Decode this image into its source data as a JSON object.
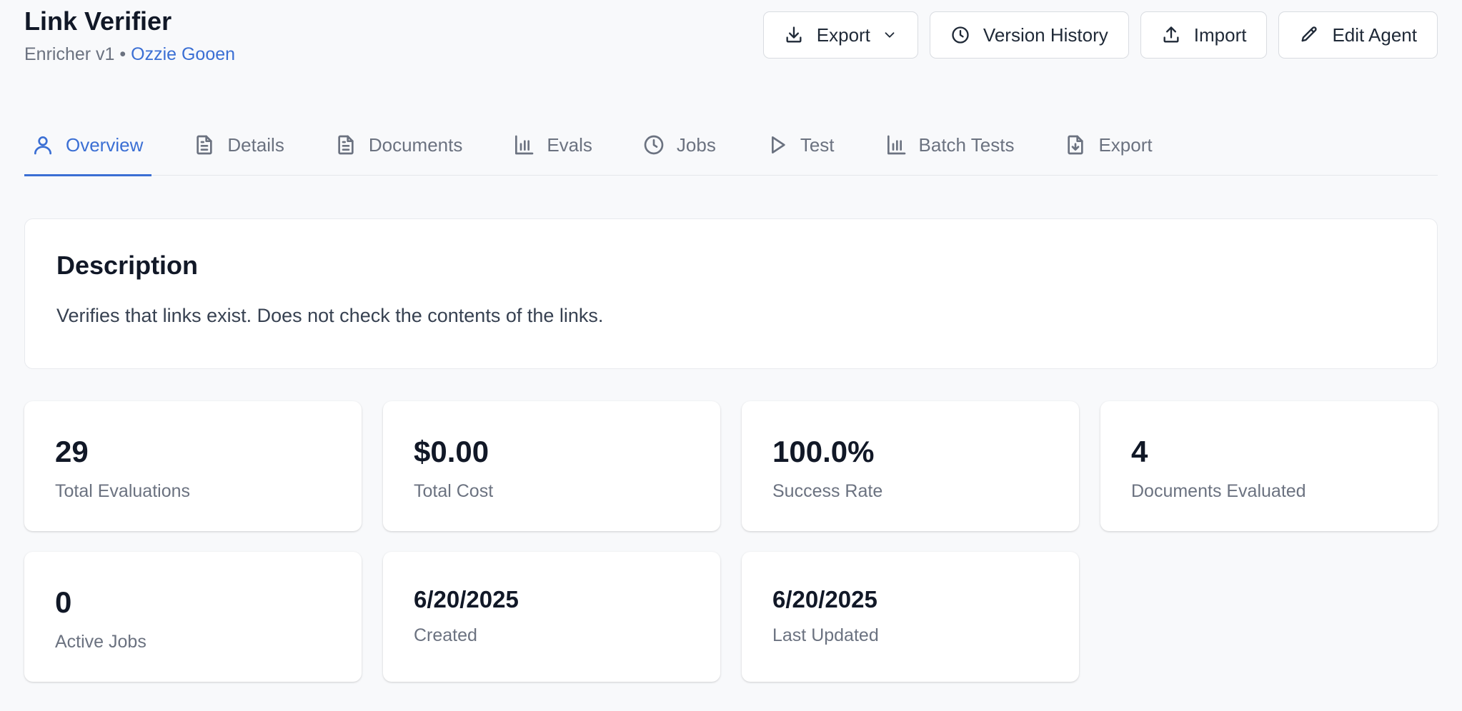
{
  "header": {
    "title": "Link Verifier",
    "version": "Enricher v1",
    "separator": "•",
    "author": "Ozzie Gooen"
  },
  "actions": {
    "export_label": "Export",
    "version_history_label": "Version History",
    "import_label": "Import",
    "edit_label": "Edit Agent"
  },
  "tabs": [
    {
      "label": "Overview",
      "icon": "user-icon",
      "active": true
    },
    {
      "label": "Details",
      "icon": "file-text-icon"
    },
    {
      "label": "Documents",
      "icon": "file-text-icon"
    },
    {
      "label": "Evals",
      "icon": "bar-chart-icon"
    },
    {
      "label": "Jobs",
      "icon": "clock-icon"
    },
    {
      "label": "Test",
      "icon": "play-icon"
    },
    {
      "label": "Batch Tests",
      "icon": "bar-chart-icon"
    },
    {
      "label": "Export",
      "icon": "file-download-icon"
    }
  ],
  "description": {
    "title": "Description",
    "text": "Verifies that links exist. Does not check the contents of the links."
  },
  "stats": [
    {
      "value": "29",
      "label": "Total Evaluations"
    },
    {
      "value": "$0.00",
      "label": "Total Cost"
    },
    {
      "value": "100.0%",
      "label": "Success Rate"
    },
    {
      "value": "4",
      "label": "Documents Evaluated"
    },
    {
      "value": "0",
      "label": "Active Jobs"
    },
    {
      "value": "6/20/2025",
      "label": "Created"
    },
    {
      "value": "6/20/2025",
      "label": "Last Updated"
    }
  ],
  "colors": {
    "accent": "#3b6fd4",
    "background": "#f8f9fb"
  }
}
